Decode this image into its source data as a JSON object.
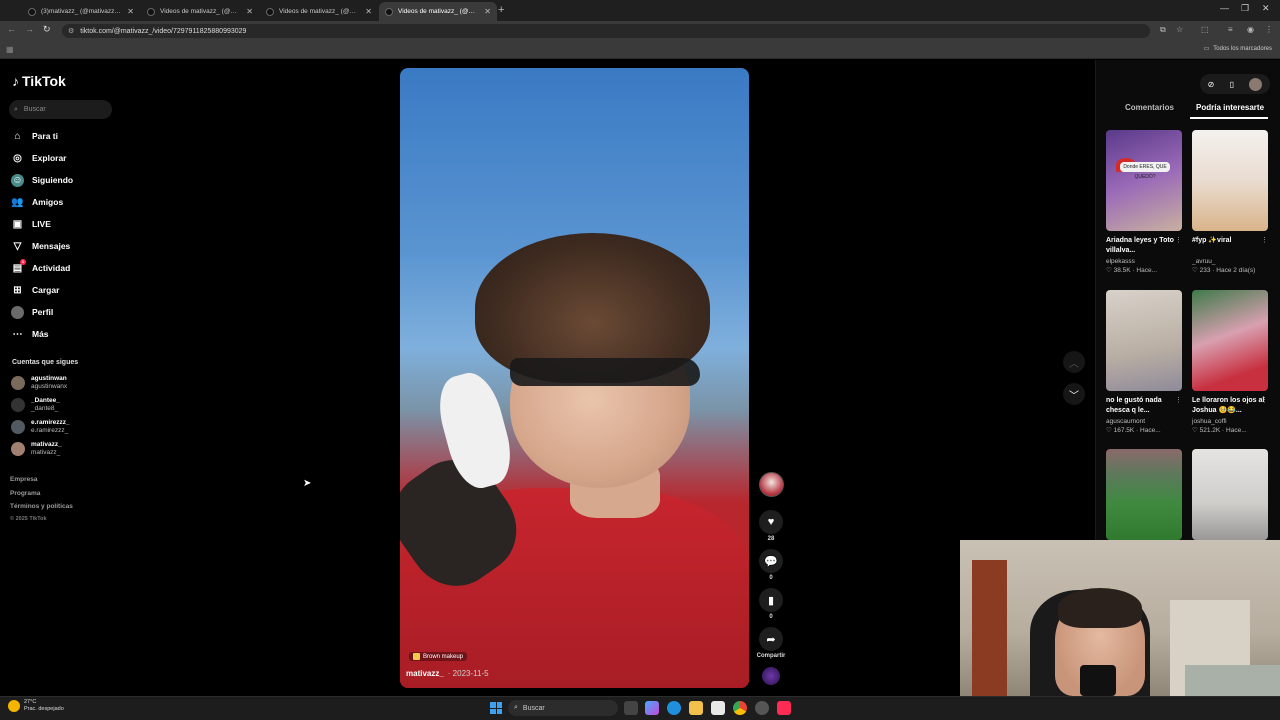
{
  "browser": {
    "tabs": [
      {
        "title": "(3)mativazz_ (@mativazz_) | Tik",
        "active": false
      },
      {
        "title": "Videos de mativazz_ (@mativaz",
        "active": false
      },
      {
        "title": "Videos de mativazz_ (@mativaz",
        "active": false
      },
      {
        "title": "Videos de mativazz_ (@mativaz",
        "active": true
      }
    ],
    "new_tab": "+",
    "url": "tiktok.com/@mativazz_/video/7297911825880993029",
    "bookmarks_all": "Todos los marcadores"
  },
  "sidebar": {
    "logo": "TikTok",
    "search_placeholder": "Buscar",
    "nav": [
      {
        "label": "Para ti",
        "icon": "home-icon"
      },
      {
        "label": "Explorar",
        "icon": "compass-icon"
      },
      {
        "label": "Siguiendo",
        "icon": "following-icon"
      },
      {
        "label": "Amigos",
        "icon": "friends-icon"
      },
      {
        "label": "LIVE",
        "icon": "live-icon"
      },
      {
        "label": "Mensajes",
        "icon": "messages-icon"
      },
      {
        "label": "Actividad",
        "icon": "activity-icon",
        "badge": "1"
      },
      {
        "label": "Cargar",
        "icon": "upload-icon"
      },
      {
        "label": "Perfil",
        "icon": "profile-icon"
      },
      {
        "label": "Más",
        "icon": "more-icon"
      }
    ],
    "following_title": "Cuentas que sigues",
    "following": [
      {
        "username": "agustinwan",
        "name": "agustinwanx"
      },
      {
        "username": "_Dantee_",
        "name": "_dante8_"
      },
      {
        "username": "e.ramirezzz_",
        "name": "e.ramirezzz_"
      },
      {
        "username": "mativazz_",
        "name": "mativazz_"
      }
    ],
    "footer": [
      "Empresa",
      "Programa",
      "Términos y políticas"
    ],
    "copyright": "© 2025 TikTok"
  },
  "video": {
    "effect": "Brown makeup",
    "author": "mativazz_",
    "date": "· 2023-11-5",
    "likes": "28",
    "comments": "0",
    "saves": "0",
    "share_label": "Compartir"
  },
  "right_panel": {
    "tab_comments": "Comentarios",
    "tab_interest": "Podría interesarte",
    "cards": [
      {
        "title": "Ariadna leyes y Toto villalva...",
        "user": "elpekasss",
        "likes": "38.5K",
        "time": "Hace...",
        "thumb_text": "Donde ERES, QUE QUEDÓ?"
      },
      {
        "title": "#fyp ✨viral",
        "user": "_avruu_",
        "likes": "233",
        "time": "Hace 2 día(s)",
        "thumb_text": ""
      },
      {
        "title": "no le gustó nada chesca q le...",
        "user": "aguscaumont",
        "likes": "167.5K",
        "time": "Hace...",
        "thumb_text": ""
      },
      {
        "title": "Le lloraron los ojos al Joshua 🥺😂...",
        "user": "joshua_coffi",
        "likes": "521.2K",
        "time": "Hace...",
        "thumb_text": ""
      },
      {
        "title": "",
        "user": "",
        "likes": "",
        "time": "",
        "thumb_text": ""
      },
      {
        "title": "",
        "user": "",
        "likes": "",
        "time": "",
        "thumb_text": ""
      }
    ]
  },
  "taskbar": {
    "temp": "27°C",
    "weather": "Prac. despejado",
    "search": "Buscar"
  }
}
